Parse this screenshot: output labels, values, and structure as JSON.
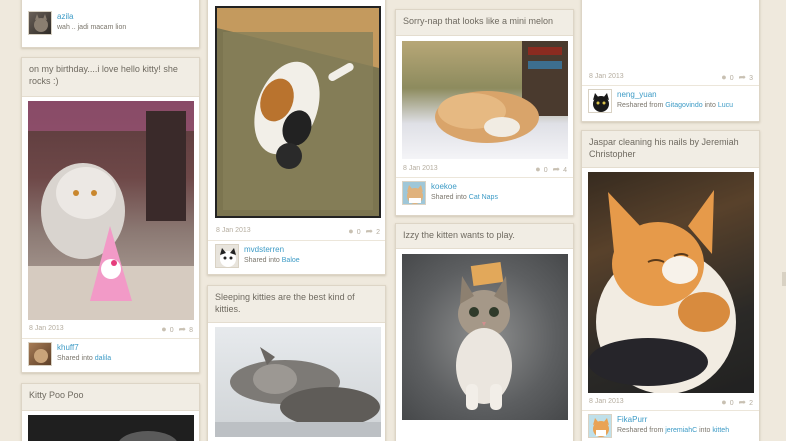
{
  "col1": {
    "top_card": {
      "user": "azila",
      "comment": "wah .. jadi macam lion"
    },
    "bday_card": {
      "title": "on my birthday....i love hello kitty! she rocks :)",
      "date": "8 Jan 2013",
      "comments": "0",
      "repins": "8",
      "user": "khuff7",
      "shared_prefix": "Shared into",
      "board": "dalila"
    },
    "kitty_card": {
      "title": "Kitty Poo Poo"
    }
  },
  "col2": {
    "tatami_card": {
      "date": "8 Jan 2013",
      "comments": "0",
      "repins": "2",
      "user": "mvdsterren",
      "shared_prefix": "Shared into",
      "board": "Baloe"
    },
    "sleeping_card": {
      "title": "Sleeping kitties are the best kind of kitties."
    }
  },
  "col3": {
    "melon_card": {
      "title": "Sorry-nap that looks like a mini melon",
      "date": "8 Jan 2013",
      "comments": "0",
      "repins": "4",
      "user": "koekoe",
      "shared_prefix": "Shared into",
      "board": "Cat Naps"
    },
    "izzy_card": {
      "title": "Izzy the kitten wants to play."
    }
  },
  "col4": {
    "top_card": {
      "date": "8 Jan 2013",
      "comments": "0",
      "repins": "3",
      "user": "neng_yuan",
      "reshared_prefix": "Reshared from",
      "from_user": "Gitagovindo",
      "into": "into",
      "board": "Lucu"
    },
    "jaspar_card": {
      "title": "Jaspar cleaning his nails by Jeremiah Christopher",
      "date": "8 Jan 2013",
      "comments": "0",
      "repins": "2",
      "user": "FikaPurr",
      "reshared_prefix": "Reshared from",
      "from_user": "jeremiahC",
      "into": "into",
      "board": "kitteh"
    }
  },
  "colors": {
    "background": "#efe9dd",
    "link": "#3d9bc6",
    "title_bar": "#f1ede4"
  }
}
